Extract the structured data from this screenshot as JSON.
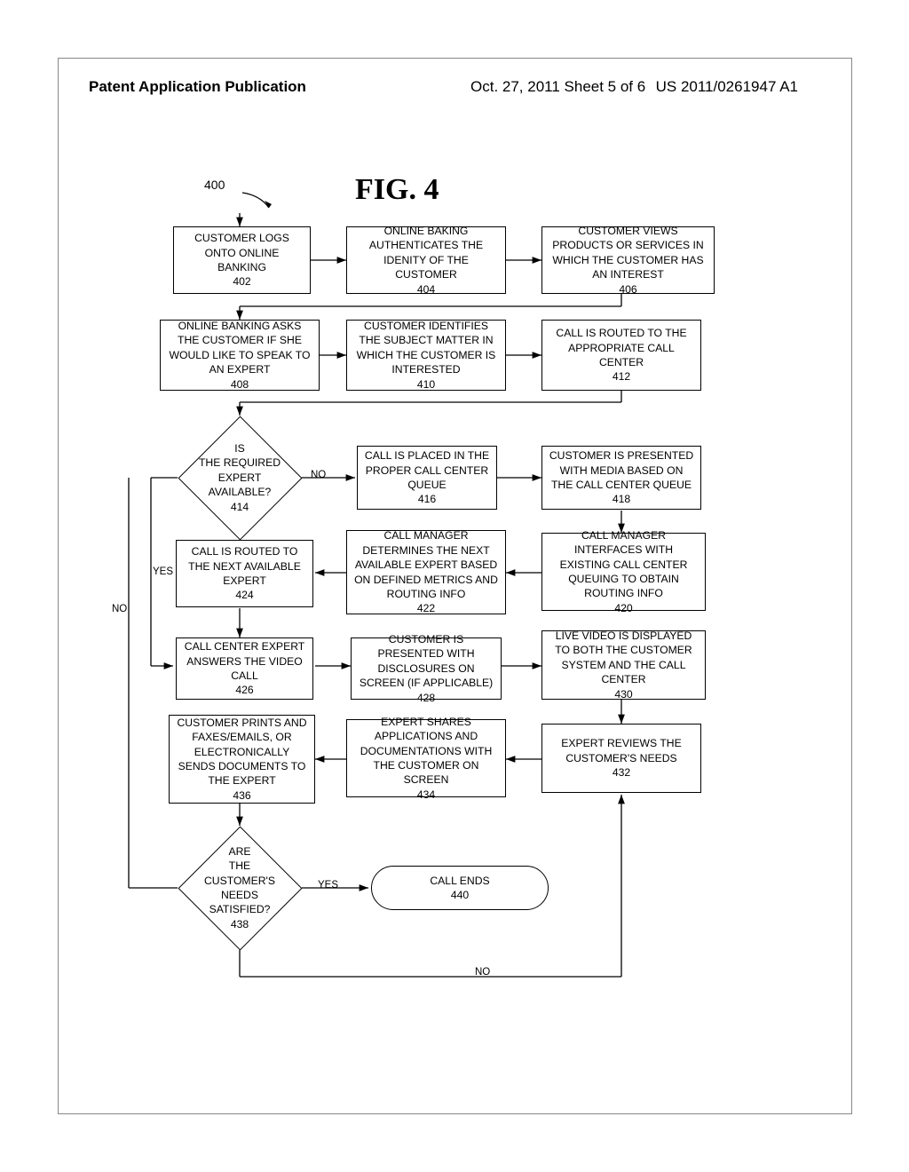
{
  "header": {
    "left": "Patent Application Publication",
    "mid": "Oct. 27, 2011   Sheet 5 of 6",
    "right": "US 2011/0261947 A1"
  },
  "figure": {
    "title": "FIG. 4",
    "ref": "400"
  },
  "labels": {
    "no1": "NO",
    "yes1": "YES",
    "no2": "NO",
    "yes2": "YES",
    "no3": "NO"
  },
  "boxes": {
    "b402": "CUSTOMER LOGS ONTO ONLINE BANKING\n402",
    "b404": "ONLINE BAKING AUTHENTICATES THE IDENITY OF THE CUSTOMER\n404",
    "b406": "CUSTOMER VIEWS  PRODUCTS OR SERVICES IN WHICH THE CUSTOMER HAS AN INTEREST\n406",
    "b408": "ONLINE BANKING ASKS THE CUSTOMER IF SHE WOULD LIKE TO SPEAK TO AN EXPERT\n408",
    "b410": "CUSTOMER IDENTIFIES THE SUBJECT MATTER IN WHICH THE CUSTOMER IS INTERESTED\n410",
    "b412": "CALL IS ROUTED TO THE APPROPRIATE CALL CENTER\n412",
    "d414": "IS\nTHE REQUIRED\nEXPERT\nAVAILABLE?\n414",
    "b416": "CALL IS PLACED IN THE PROPER CALL CENTER QUEUE\n416",
    "b418": "CUSTOMER IS PRESENTED WITH MEDIA BASED ON THE CALL CENTER QUEUE\n418",
    "b420": "CALL MANAGER INTERFACES WITH EXISTING CALL CENTER QUEUING TO OBTAIN ROUTING INFO\n420",
    "b422": "CALL MANAGER DETERMINES THE NEXT AVAILABLE EXPERT BASED ON DEFINED METRICS AND ROUTING INFO\n422",
    "b424": "CALL IS ROUTED TO THE NEXT AVAILABLE EXPERT\n424",
    "b426": "CALL CENTER EXPERT ANSWERS THE VIDEO CALL\n426",
    "b428": "CUSTOMER IS PRESENTED WITH DISCLOSURES ON SCREEN (IF APPLICABLE)\n428",
    "b430": "LIVE VIDEO IS DISPLAYED TO BOTH THE CUSTOMER SYSTEM AND THE CALL CENTER\n430",
    "b432": "EXPERT REVIEWS THE CUSTOMER'S NEEDS\n432",
    "b434": "EXPERT SHARES APPLICATIONS AND DOCUMENTATIONS WITH THE CUSTOMER ON SCREEN\n434",
    "b436": "CUSTOMER PRINTS AND FAXES/EMAILS, OR ELECTRONICALLY SENDS DOCUMENTS TO THE EXPERT\n436",
    "d438": "ARE\nTHE\nCUSTOMER'S\nNEEDS\nSATISFIED?\n438",
    "t440": "CALL ENDS\n440"
  },
  "chart_data": {
    "type": "flowchart",
    "title": "FIG. 4",
    "reference_numeral": "400",
    "nodes": [
      {
        "id": "402",
        "type": "process",
        "text": "CUSTOMER LOGS ONTO ONLINE BANKING"
      },
      {
        "id": "404",
        "type": "process",
        "text": "ONLINE BAKING AUTHENTICATES THE IDENITY OF THE CUSTOMER"
      },
      {
        "id": "406",
        "type": "process",
        "text": "CUSTOMER VIEWS PRODUCTS OR SERVICES IN WHICH THE CUSTOMER HAS AN INTEREST"
      },
      {
        "id": "408",
        "type": "process",
        "text": "ONLINE BANKING ASKS THE CUSTOMER IF SHE WOULD LIKE TO SPEAK TO AN EXPERT"
      },
      {
        "id": "410",
        "type": "process",
        "text": "CUSTOMER IDENTIFIES THE SUBJECT MATTER IN WHICH THE CUSTOMER IS INTERESTED"
      },
      {
        "id": "412",
        "type": "process",
        "text": "CALL IS ROUTED TO THE APPROPRIATE CALL CENTER"
      },
      {
        "id": "414",
        "type": "decision",
        "text": "IS THE REQUIRED EXPERT AVAILABLE?"
      },
      {
        "id": "416",
        "type": "process",
        "text": "CALL IS PLACED IN THE PROPER CALL CENTER QUEUE"
      },
      {
        "id": "418",
        "type": "process",
        "text": "CUSTOMER IS PRESENTED WITH MEDIA BASED ON THE CALL CENTER QUEUE"
      },
      {
        "id": "420",
        "type": "process",
        "text": "CALL MANAGER INTERFACES WITH EXISTING CALL CENTER QUEUING TO OBTAIN ROUTING INFO"
      },
      {
        "id": "422",
        "type": "process",
        "text": "CALL MANAGER DETERMINES THE NEXT AVAILABLE EXPERT BASED ON DEFINED METRICS AND ROUTING INFO"
      },
      {
        "id": "424",
        "type": "process",
        "text": "CALL IS ROUTED TO THE NEXT AVAILABLE EXPERT"
      },
      {
        "id": "426",
        "type": "process",
        "text": "CALL CENTER EXPERT ANSWERS THE VIDEO CALL"
      },
      {
        "id": "428",
        "type": "process",
        "text": "CUSTOMER IS PRESENTED WITH DISCLOSURES ON SCREEN (IF APPLICABLE)"
      },
      {
        "id": "430",
        "type": "process",
        "text": "LIVE VIDEO IS DISPLAYED TO BOTH THE CUSTOMER SYSTEM AND THE CALL CENTER"
      },
      {
        "id": "432",
        "type": "process",
        "text": "EXPERT REVIEWS THE CUSTOMER'S NEEDS"
      },
      {
        "id": "434",
        "type": "process",
        "text": "EXPERT SHARES APPLICATIONS AND DOCUMENTATIONS WITH THE CUSTOMER ON SCREEN"
      },
      {
        "id": "436",
        "type": "process",
        "text": "CUSTOMER PRINTS AND FAXES/EMAILS, OR ELECTRONICALLY SENDS DOCUMENTS TO THE EXPERT"
      },
      {
        "id": "438",
        "type": "decision",
        "text": "ARE THE CUSTOMER'S NEEDS SATISFIED?"
      },
      {
        "id": "440",
        "type": "terminator",
        "text": "CALL ENDS"
      }
    ],
    "edges": [
      {
        "from": "start",
        "to": "402"
      },
      {
        "from": "402",
        "to": "404"
      },
      {
        "from": "404",
        "to": "406"
      },
      {
        "from": "406",
        "to": "408"
      },
      {
        "from": "408",
        "to": "410"
      },
      {
        "from": "410",
        "to": "412"
      },
      {
        "from": "412",
        "to": "414"
      },
      {
        "from": "414",
        "to": "416",
        "label": "NO"
      },
      {
        "from": "414",
        "to": "426",
        "label": "YES"
      },
      {
        "from": "416",
        "to": "418"
      },
      {
        "from": "418",
        "to": "420"
      },
      {
        "from": "420",
        "to": "422"
      },
      {
        "from": "422",
        "to": "424"
      },
      {
        "from": "424",
        "to": "426"
      },
      {
        "from": "426",
        "to": "428"
      },
      {
        "from": "428",
        "to": "430"
      },
      {
        "from": "430",
        "to": "432"
      },
      {
        "from": "432",
        "to": "434"
      },
      {
        "from": "434",
        "to": "436"
      },
      {
        "from": "436",
        "to": "438"
      },
      {
        "from": "438",
        "to": "440",
        "label": "YES"
      },
      {
        "from": "438",
        "to": "432",
        "label": "NO"
      },
      {
        "from": "438",
        "to": "426",
        "label": "NO",
        "note": "left-side NO loop also returns to 426"
      }
    ]
  }
}
